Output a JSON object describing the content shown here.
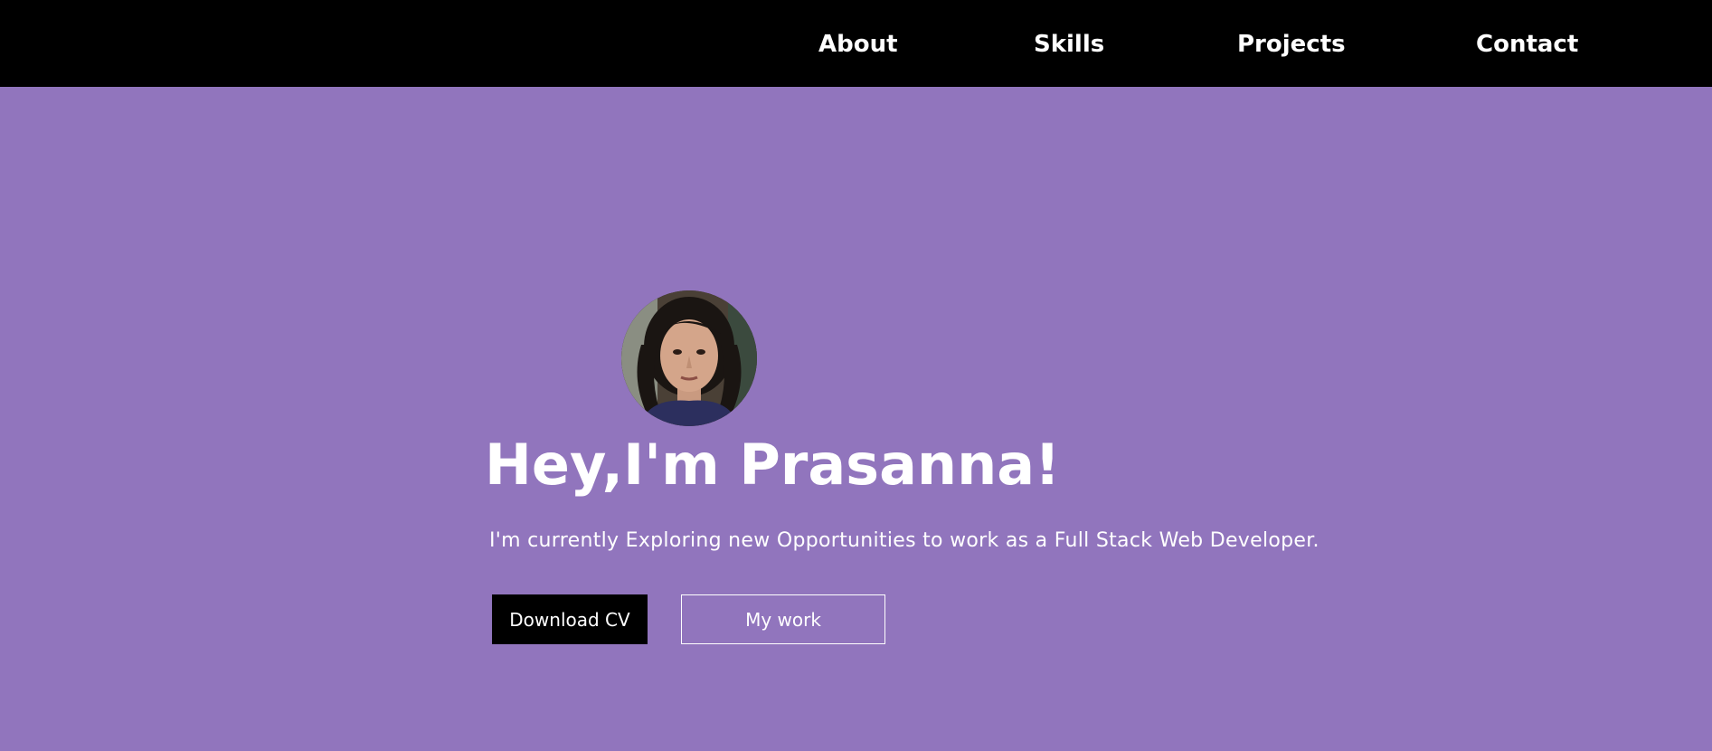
{
  "nav": {
    "items": [
      {
        "label": "About"
      },
      {
        "label": "Skills"
      },
      {
        "label": "Projects"
      },
      {
        "label": "Contact"
      }
    ]
  },
  "hero": {
    "title": "Hey,I'm Prasanna!",
    "subtitle": "I'm currently Exploring new Opportunities to work as a Full Stack Web Developer.",
    "buttons": {
      "download_label": "Download CV",
      "work_label": "My work"
    }
  },
  "colors": {
    "nav_background": "#000000",
    "hero_background": "#9175bd",
    "text": "#ffffff",
    "primary_button": "#000000"
  }
}
